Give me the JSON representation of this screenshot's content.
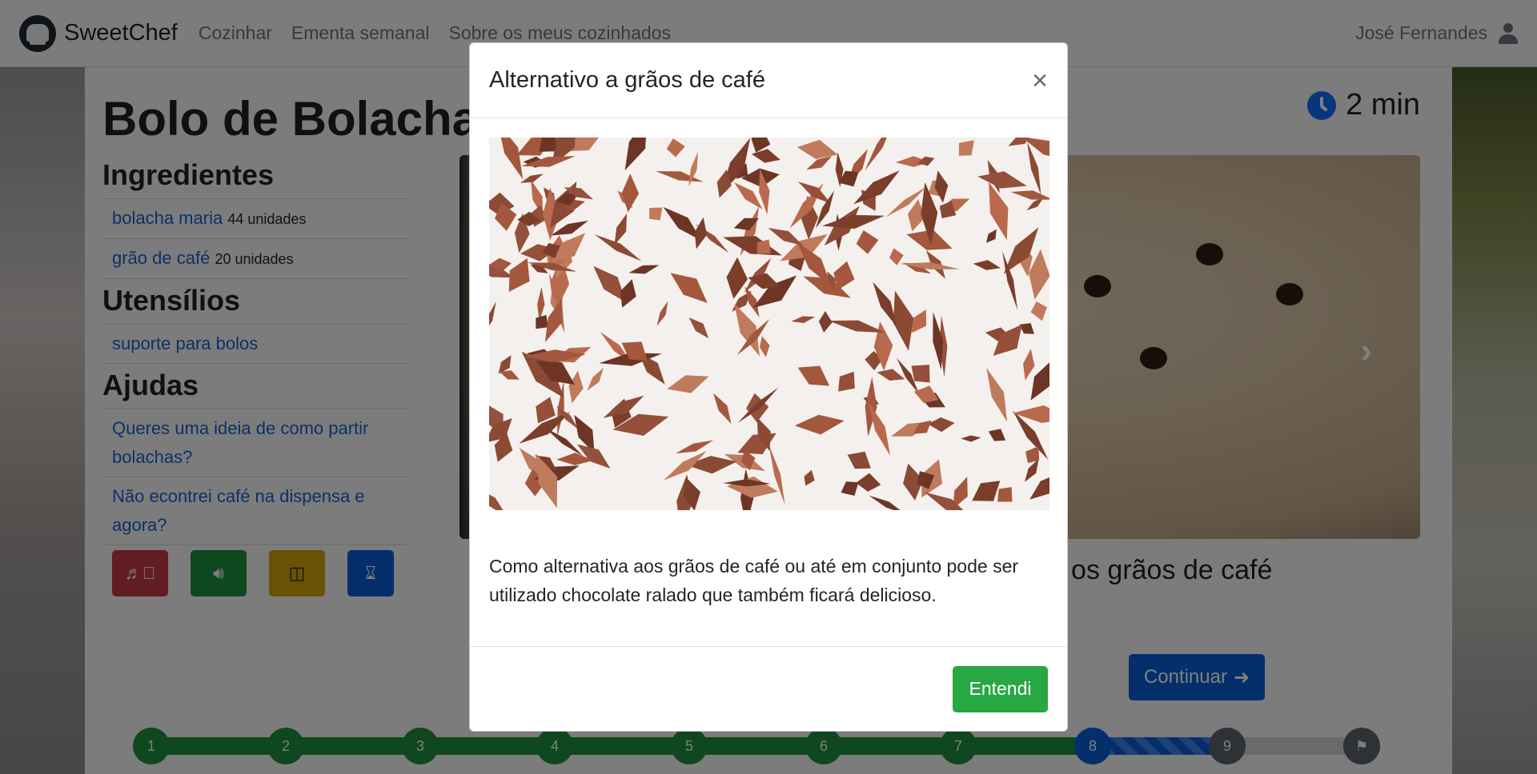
{
  "navbar": {
    "brand": "SweetChef",
    "links": [
      "Cozinhar",
      "Ementa semanal",
      "Sobre os meus cozinhados"
    ],
    "user": "José Fernandes"
  },
  "recipe": {
    "title": "Bolo de Bolacha",
    "timer": "2 min",
    "ingredients_heading": "Ingredientes",
    "ingredients": [
      {
        "name": "bolacha maria",
        "qty": "44 unidades"
      },
      {
        "name": "grão de café",
        "qty": "20 unidades"
      }
    ],
    "utensils_heading": "Utensílios",
    "utensils": [
      "suporte para bolos"
    ],
    "help_heading": "Ajudas",
    "help": [
      "Queres uma ideia de como partir bolachas?",
      "Não econtrei café na dispensa e agora?"
    ],
    "step_text_visible": "e com os grãos de café",
    "continue_label": "Continuar"
  },
  "tools": [
    "mute-icon",
    "volume-icon",
    "note-icon",
    "hourglass-icon"
  ],
  "progress": {
    "steps": [
      "1",
      "2",
      "3",
      "4",
      "5",
      "6",
      "7",
      "8",
      "9"
    ],
    "current_step": 8,
    "total_steps": 10,
    "colors": {
      "done": "#1e8f3e",
      "current": "#0b5fd4",
      "todo": "#5c636a"
    }
  },
  "modal": {
    "title": "Alternativo a grãos de café",
    "close": "×",
    "body": "Como alternativa aos grãos de café ou até em conjunto pode ser utilizado chocolate ralado que também ficará delicioso.",
    "confirm_label": "Entendi"
  }
}
